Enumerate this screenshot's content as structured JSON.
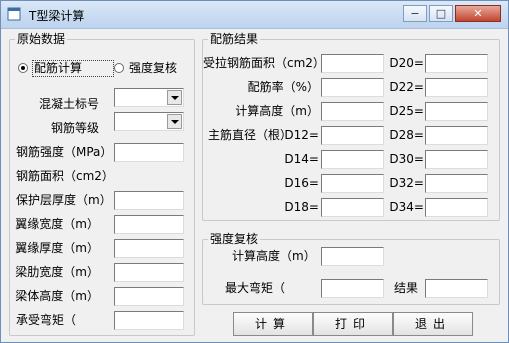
{
  "window": {
    "title": "T型梁计算",
    "minimize_glyph": "−",
    "maximize_glyph": "□",
    "close_glyph": "✕"
  },
  "left_group": {
    "title": "原始数据",
    "radio_design": "配筋计算",
    "radio_check": "强度复核",
    "fields": [
      {
        "label": "混凝土标号",
        "value": ""
      },
      {
        "label": "钢筋等级",
        "value": ""
      },
      {
        "label": "钢筋强度（MPa）",
        "value": ""
      },
      {
        "label": "钢筋面积（cm2）",
        "value": ""
      },
      {
        "label": "保护层厚度（m）",
        "value": ""
      },
      {
        "label": "翼缘宽度（m）",
        "value": ""
      },
      {
        "label": "翼缘厚度（m）",
        "value": ""
      },
      {
        "label": "梁肋宽度（m）",
        "value": ""
      },
      {
        "label": "梁体高度（m）",
        "value": ""
      },
      {
        "label": "承受弯矩（",
        "value": ""
      }
    ]
  },
  "result_group": {
    "title": "配筋结果",
    "area_label": "受拉钢筋面积（cm2）",
    "ratio_label": "配筋率（%）",
    "height_label": "计算高度（m）",
    "count_label": "主筋直径（根）",
    "bars": [
      "D12=",
      "D14=",
      "D16=",
      "D18=",
      "D20=",
      "D22=",
      "D25=",
      "D28=",
      "D30=",
      "D32=",
      "D34="
    ]
  },
  "check_group": {
    "title": "强度复核",
    "height_label": "计算高度（m）",
    "moment_label": "最大弯矩（",
    "result_label": "结果"
  },
  "buttons": {
    "calc": "计算",
    "print": "打印",
    "exit": "退出"
  }
}
